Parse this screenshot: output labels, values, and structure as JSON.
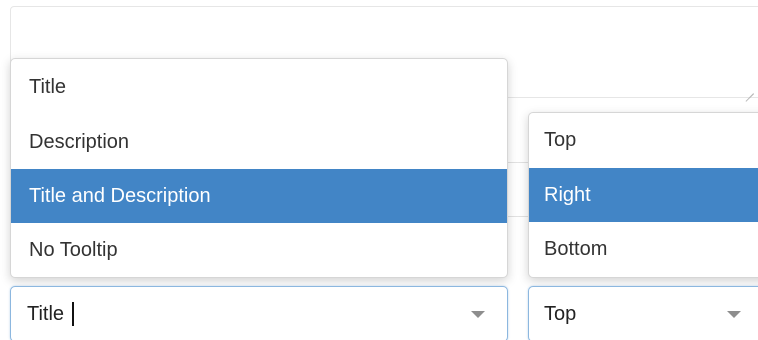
{
  "tooltip_content": {
    "options": [
      "Title",
      "Description",
      "Title and Description",
      "No Tooltip"
    ],
    "highlighted": "Title and Description",
    "value": "Title"
  },
  "tooltip_position": {
    "options": [
      "Top",
      "Right",
      "Bottom"
    ],
    "highlighted": "Right",
    "value": "Top"
  },
  "colors": {
    "highlight": "#4285c6",
    "focus_border": "#8cb7df"
  }
}
